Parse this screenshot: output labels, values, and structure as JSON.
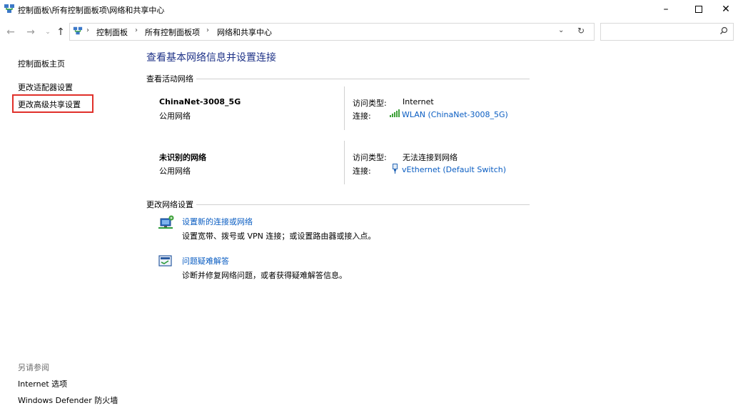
{
  "window": {
    "title": "控制面板\\所有控制面板项\\网络和共享中心",
    "icon": "network-control-panel-icon"
  },
  "nav": {
    "breadcrumb": [
      "控制面板",
      "所有控制面板项",
      "网络和共享中心"
    ],
    "search_placeholder": ""
  },
  "sidebar": {
    "home": "控制面板主页",
    "links": [
      "更改适配器设置",
      "更改高级共享设置"
    ],
    "see_also_title": "另请参阅",
    "see_also": [
      "Internet 选项",
      "Windows Defender 防火墙"
    ]
  },
  "main": {
    "title": "查看基本网络信息并设置连接",
    "active_section": "查看活动网络",
    "networks": [
      {
        "name": "ChinaNet-3008_5G",
        "category": "公用网络",
        "access_label": "访问类型:",
        "access_value": "Internet",
        "conn_label": "连接:",
        "conn_value": "WLAN (ChinaNet-3008_5G)"
      },
      {
        "name": "未识别的网络",
        "category": "公用网络",
        "access_label": "访问类型:",
        "access_value": "无法连接到网络",
        "conn_label": "连接:",
        "conn_value": "vEthernet (Default Switch)"
      }
    ],
    "change_section": "更改网络设置",
    "tasks": [
      {
        "title": "设置新的连接或网络",
        "desc": "设置宽带、拨号或 VPN 连接；或设置路由器或接入点。"
      },
      {
        "title": "问题疑难解答",
        "desc": "诊断并修复网络问题，或者获得疑难解答信息。"
      }
    ]
  },
  "colors": {
    "accent": "#1e3287",
    "link": "#0a5dc2",
    "highlight": "#e0302a"
  }
}
